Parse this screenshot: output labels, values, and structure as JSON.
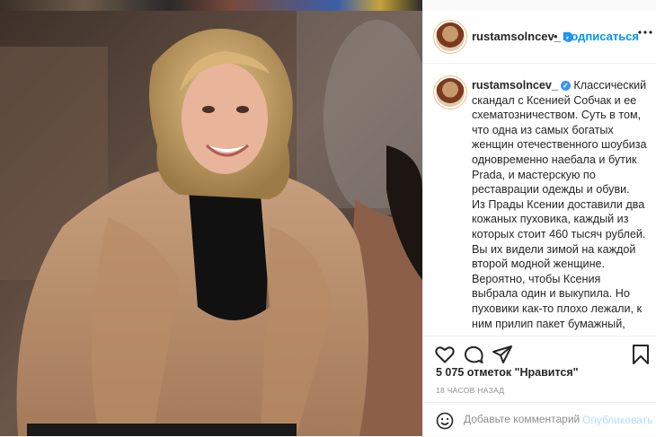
{
  "post": {
    "username": "rustamsolncev_",
    "verified": true,
    "follow_label": "Подписаться",
    "separator": "•",
    "more_label": "•••"
  },
  "caption": {
    "username": "rustamsolncev_",
    "paragraph1": "Классический скандал с Ксенией Собчак и ее схематозничеством. Суть в том, что одна из самых богатых женщин отечественного шоубиза одновременно наебала и бутик Prada, и мастерскую по реставрации одежды и обуви.",
    "paragraph2": "Из Прады Ксении доставили два кожаных пуховика, каждый из которых стоит 460 тысяч рублей. Вы их видели зимой на каждой второй модной женщине. Вероятно, чтобы Ксения выбрала один и выкупила. Но пуховики как-то плохо лежали, к ним прилип пакет бумажный, остались следы, местами слезла краска. Дальше помощница Ксении обратилась в мастерскую. Там сказали, что работа сложная,"
  },
  "actions": {
    "like_icon": "heart-icon",
    "comment_icon": "comment-icon",
    "share_icon": "share-icon",
    "save_icon": "bookmark-icon"
  },
  "likes_text": "5 075 отметок \"Нравится\"",
  "time_text": "18 ЧАСОВ НАЗАД",
  "add_comment": {
    "placeholder": "Добавьте комментарий...",
    "publish_label": "Опубликовать",
    "emoji_icon": "smiley-icon"
  },
  "colors": {
    "link_blue": "#0095f6",
    "publish_disabled": "#b2dffc",
    "verified_blue": "#3897f0"
  }
}
